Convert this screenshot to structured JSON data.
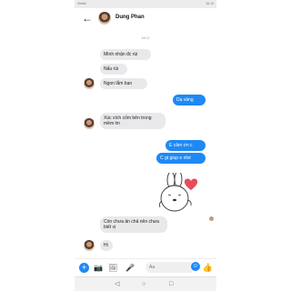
{
  "status_bar": {
    "left": "Viettel",
    "right": "18:13"
  },
  "header": {
    "back_glyph": "←",
    "contact_name": "Dung Phan"
  },
  "timestamp": "18:12",
  "messages": [
    {
      "side": "in",
      "text": "Mình nhận đc rùi"
    },
    {
      "side": "in",
      "text": "Nấu rùi"
    },
    {
      "side": "in",
      "text": "Ngon lắm bạn"
    },
    {
      "side": "out",
      "text": "Dạ vâng"
    },
    {
      "side": "in",
      "text": "Xúc xích cốm bên trong mềm lm"
    },
    {
      "side": "out",
      "text": "E cảm ơn c"
    },
    {
      "side": "out",
      "text": "C gt giup e nhé"
    },
    {
      "side": "in",
      "text": "Còn chưa ăn chả nên chưa biết vị"
    },
    {
      "side": "in",
      "text": "Hi"
    }
  ],
  "composer": {
    "placeholder": "Aa"
  },
  "colors": {
    "accent": "#1e89f5",
    "incoming_bubble": "#e9e9eb",
    "sticker_heart": "#e84c5a"
  },
  "icons": [
    "back-icon",
    "plus-icon",
    "camera-icon",
    "gallery-icon",
    "mic-icon",
    "emoji-icon",
    "like-icon"
  ]
}
